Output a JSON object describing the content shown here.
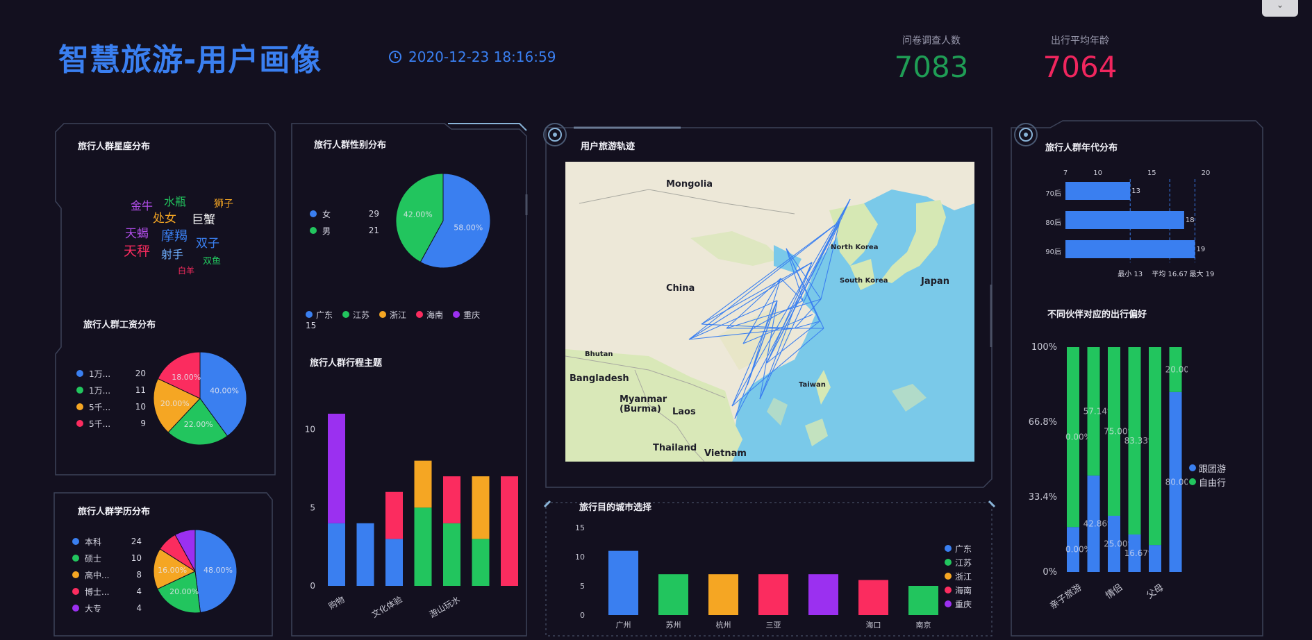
{
  "header": {
    "title": "智慧旅游-用户画像",
    "datetime": "2020-12-23 18:16:59",
    "stats": [
      {
        "label": "问卷调查人数",
        "value": "7083",
        "color": "#1f9d55"
      },
      {
        "label": "出行平均年龄",
        "value": "7064",
        "color": "#f0265e"
      }
    ]
  },
  "colors": {
    "blue": "#3a7ff0",
    "green": "#22c55e",
    "orange": "#f5a623",
    "red": "#fb2c5f",
    "purple": "#9b30f0"
  },
  "zodiac": {
    "title": "旅行人群星座分布",
    "words": [
      {
        "text": "金牛",
        "color": "#b04de8",
        "size": 16
      },
      {
        "text": "水瓶",
        "color": "#22c55e",
        "size": 16
      },
      {
        "text": "狮子",
        "color": "#f5a623",
        "size": 14
      },
      {
        "text": "处女",
        "color": "#f5a623",
        "size": 17
      },
      {
        "text": "巨蟹",
        "color": "#f2f2f2",
        "size": 17
      },
      {
        "text": "天蝎",
        "color": "#b04de8",
        "size": 17
      },
      {
        "text": "摩羯",
        "color": "#3a7ff0",
        "size": 19
      },
      {
        "text": "双子",
        "color": "#3a7ff0",
        "size": 17
      },
      {
        "text": "天秤",
        "color": "#fb2c5f",
        "size": 19
      },
      {
        "text": "射手",
        "color": "#6fb0ff",
        "size": 16
      },
      {
        "text": "双鱼",
        "color": "#22c55e",
        "size": 13
      },
      {
        "text": "白羊",
        "color": "#fb2c5f",
        "size": 12
      }
    ]
  },
  "salary": {
    "title": "旅行人群工资分布",
    "legend": [
      {
        "name": "1万...",
        "value": "20",
        "color": "#3a7ff0"
      },
      {
        "name": "1万...",
        "value": "11",
        "color": "#22c55e"
      },
      {
        "name": "5千...",
        "value": "10",
        "color": "#f5a623"
      },
      {
        "name": "5千...",
        "value": "9",
        "color": "#fb2c5f"
      }
    ],
    "slices": [
      {
        "value": 40,
        "label": "40.00%",
        "color": "#3a7ff0"
      },
      {
        "value": 22,
        "label": "22.00%",
        "color": "#22c55e"
      },
      {
        "value": 20,
        "label": "20.00%",
        "color": "#f5a623"
      },
      {
        "value": 18,
        "label": "18.00%",
        "color": "#fb2c5f"
      }
    ]
  },
  "education": {
    "title": "旅行人群学历分布",
    "legend": [
      {
        "name": "本科",
        "value": "24",
        "color": "#3a7ff0"
      },
      {
        "name": "硕士",
        "value": "10",
        "color": "#22c55e"
      },
      {
        "name": "高中...",
        "value": "8",
        "color": "#f5a623"
      },
      {
        "name": "博士...",
        "value": "4",
        "color": "#fb2c5f"
      },
      {
        "name": "大专",
        "value": "4",
        "color": "#9b30f0"
      }
    ],
    "slices": [
      {
        "value": 48,
        "label": "48.00%",
        "color": "#3a7ff0"
      },
      {
        "value": 20,
        "label": "20.00%",
        "color": "#22c55e"
      },
      {
        "value": 16,
        "label": "16.00%",
        "color": "#f5a623"
      },
      {
        "value": 8,
        "label": "",
        "color": "#fb2c5f"
      },
      {
        "value": 8,
        "label": "",
        "color": "#9b30f0"
      }
    ]
  },
  "gender": {
    "title": "旅行人群性别分布",
    "legend": [
      {
        "name": "女",
        "value": "29",
        "color": "#3a7ff0"
      },
      {
        "name": "男",
        "value": "21",
        "color": "#22c55e"
      }
    ],
    "slices": [
      {
        "value": 58,
        "label": "58.00%",
        "color": "#3a7ff0"
      },
      {
        "value": 42,
        "label": "42.00%",
        "color": "#22c55e"
      }
    ]
  },
  "trip_theme": {
    "title": "旅行人群行程主题",
    "legend": [
      {
        "name": "广东",
        "color": "#3a7ff0"
      },
      {
        "name": "江苏",
        "color": "#22c55e"
      },
      {
        "name": "浙江",
        "color": "#f5a623"
      },
      {
        "name": "海南",
        "color": "#fb2c5f"
      },
      {
        "name": "重庆",
        "color": "#9b30f0"
      }
    ],
    "legend_extra": "15"
  },
  "map": {
    "title": "用户旅游轨迹",
    "labels": [
      "Mongolia",
      "China",
      "North Korea",
      "South Korea",
      "Japan",
      "Bhutan",
      "Bangladesh",
      "Myanmar\n(Burma)",
      "Laos",
      "Thailand",
      "Vietnam",
      "Taiwan"
    ]
  },
  "city_choice": {
    "title": "旅行目的城市选择",
    "legend": [
      {
        "name": "广东",
        "color": "#3a7ff0"
      },
      {
        "name": "江苏",
        "color": "#22c55e"
      },
      {
        "name": "浙江",
        "color": "#f5a623"
      },
      {
        "name": "海南",
        "color": "#fb2c5f"
      },
      {
        "name": "重庆",
        "color": "#9b30f0"
      }
    ]
  },
  "generation": {
    "title": "旅行人群年代分布",
    "footer": [
      "最小 13",
      "平均 16.67",
      "最大 19"
    ]
  },
  "companion": {
    "title": "不同伙伴对应的出行偏好",
    "legend": [
      {
        "name": "跟团游",
        "color": "#3a7ff0"
      },
      {
        "name": "自由行",
        "color": "#22c55e"
      }
    ]
  },
  "chart_data": [
    {
      "type": "bar",
      "title": "旅行人群行程主题",
      "stacked": true,
      "categories": [
        "购物",
        "",
        "文化体验",
        "",
        "游山玩水",
        "",
        ""
      ],
      "ylim": [
        0,
        10
      ],
      "yticks": [
        0,
        5,
        10
      ],
      "series": [
        {
          "name": "广东",
          "color": "#3a7ff0",
          "values": [
            4,
            4,
            3,
            0,
            0,
            0,
            0
          ]
        },
        {
          "name": "江苏",
          "color": "#22c55e",
          "values": [
            0,
            0,
            0,
            5,
            4,
            3,
            0
          ]
        },
        {
          "name": "浙江",
          "color": "#f5a623",
          "values": [
            0,
            0,
            0,
            3,
            0,
            4,
            0
          ]
        },
        {
          "name": "海南",
          "color": "#fb2c5f",
          "values": [
            0,
            0,
            3,
            0,
            3,
            0,
            7
          ]
        },
        {
          "name": "重庆",
          "color": "#9b30f0",
          "values": [
            7,
            0,
            0,
            0,
            0,
            0,
            0
          ]
        }
      ]
    },
    {
      "type": "bar",
      "title": "旅行目的城市选择",
      "categories": [
        "广州",
        "苏州",
        "杭州",
        "三亚",
        "",
        "海口",
        "南京"
      ],
      "values": [
        11,
        7,
        7,
        7,
        7,
        6,
        5
      ],
      "colors": [
        "#3a7ff0",
        "#22c55e",
        "#f5a623",
        "#fb2c5f",
        "#9b30f0",
        "#fb2c5f",
        "#22c55e"
      ],
      "ylim": [
        0,
        15
      ],
      "yticks": [
        0,
        5,
        10,
        15
      ]
    },
    {
      "type": "bar",
      "title": "旅行人群年代分布",
      "orientation": "horizontal",
      "categories": [
        "70后",
        "80后",
        "90后"
      ],
      "values": [
        13,
        18,
        19
      ],
      "xlim": [
        7,
        20
      ],
      "xticks": [
        7,
        10,
        15,
        20
      ]
    },
    {
      "type": "bar",
      "title": "不同伙伴对应的出行偏好",
      "stacked": true,
      "percent": true,
      "categories": [
        "亲子旅游",
        "",
        "情侣",
        "",
        "父母",
        ""
      ],
      "yticks": [
        "0%",
        "33.4%",
        "66.8%",
        "100%"
      ],
      "series": [
        {
          "name": "跟团游",
          "color": "#3a7ff0",
          "values": [
            20,
            42.86,
            25,
            16.67,
            12,
            80
          ],
          "labels": [
            "0.00%",
            "42.86%",
            "25.00%",
            "16.67%",
            "",
            "80.00%"
          ]
        },
        {
          "name": "自由行",
          "color": "#22c55e",
          "values": [
            80,
            57.14,
            75,
            83.33,
            88,
            20
          ],
          "labels": [
            "0.00%",
            "57.14%",
            "75.00%",
            "83.33%",
            "",
            "20.00%"
          ]
        }
      ]
    }
  ]
}
